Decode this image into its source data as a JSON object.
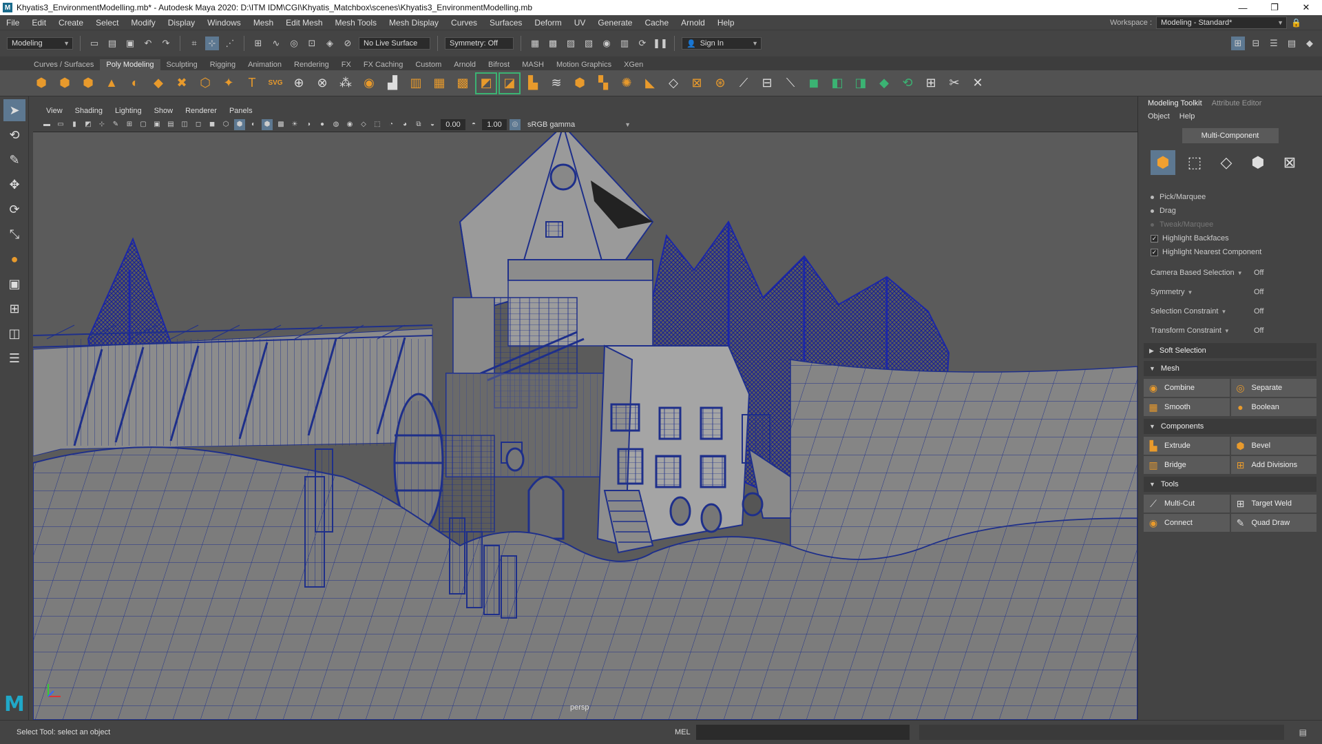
{
  "window": {
    "title": "Khyatis3_EnvironmentModelling.mb* - Autodesk Maya 2020: D:\\ITM IDM\\CGI\\Khyatis_Matchbox\\scenes\\Khyatis3_EnvironmentModelling.mb",
    "minimize": "—",
    "maximize": "❐",
    "close": "✕"
  },
  "menus": [
    "File",
    "Edit",
    "Create",
    "Select",
    "Modify",
    "Display",
    "Windows",
    "Mesh",
    "Edit Mesh",
    "Mesh Tools",
    "Mesh Display",
    "Curves",
    "Surfaces",
    "Deform",
    "UV",
    "Generate",
    "Cache",
    "Arnold",
    "Help"
  ],
  "workspace": {
    "label": "Workspace :",
    "value": "Modeling - Standard*"
  },
  "statusline": {
    "menuset": "Modeling",
    "live_surface": "No Live Surface",
    "symmetry": "Symmetry: Off",
    "signin": "Sign In"
  },
  "shelf_tabs": [
    "Curves / Surfaces",
    "Poly Modeling",
    "Sculpting",
    "Rigging",
    "Animation",
    "Rendering",
    "FX",
    "FX Caching",
    "Custom",
    "Arnold",
    "Bifrost",
    "MASH",
    "Motion Graphics",
    "XGen"
  ],
  "shelf_active": "Poly Modeling",
  "viewport": {
    "menus": [
      "View",
      "Shading",
      "Lighting",
      "Show",
      "Renderer",
      "Panels"
    ],
    "exposure": "0.00",
    "gamma": "1.00",
    "color_space": "sRGB gamma",
    "camera": "persp"
  },
  "modeling_toolkit": {
    "tabs": [
      "Modeling Toolkit",
      "Attribute Editor"
    ],
    "menu": [
      "Object",
      "Help"
    ],
    "mode_button": "Multi-Component",
    "selection_modes": [
      {
        "label": "Pick/Marquee",
        "enabled": true
      },
      {
        "label": "Drag",
        "enabled": true
      },
      {
        "label": "Tweak/Marquee",
        "enabled": false
      }
    ],
    "checks": [
      {
        "label": "Highlight Backfaces",
        "checked": true
      },
      {
        "label": "Highlight Nearest Component",
        "checked": true
      }
    ],
    "properties": [
      {
        "label": "Camera Based Selection",
        "value": "Off"
      },
      {
        "label": "Symmetry",
        "value": "Off"
      },
      {
        "label": "Selection Constraint",
        "value": "Off"
      },
      {
        "label": "Transform Constraint",
        "value": "Off"
      }
    ],
    "soft_selection": "Soft Selection",
    "sections": [
      {
        "title": "Mesh",
        "buttons": [
          "Combine",
          "Separate",
          "Smooth",
          "Boolean"
        ]
      },
      {
        "title": "Components",
        "buttons": [
          "Extrude",
          "Bevel",
          "Bridge",
          "Add Divisions"
        ]
      },
      {
        "title": "Tools",
        "buttons": [
          "Multi-Cut",
          "Target Weld",
          "Connect",
          "Quad Draw"
        ]
      }
    ]
  },
  "helpline": {
    "text": "Select Tool: select an object",
    "mel": "MEL"
  }
}
